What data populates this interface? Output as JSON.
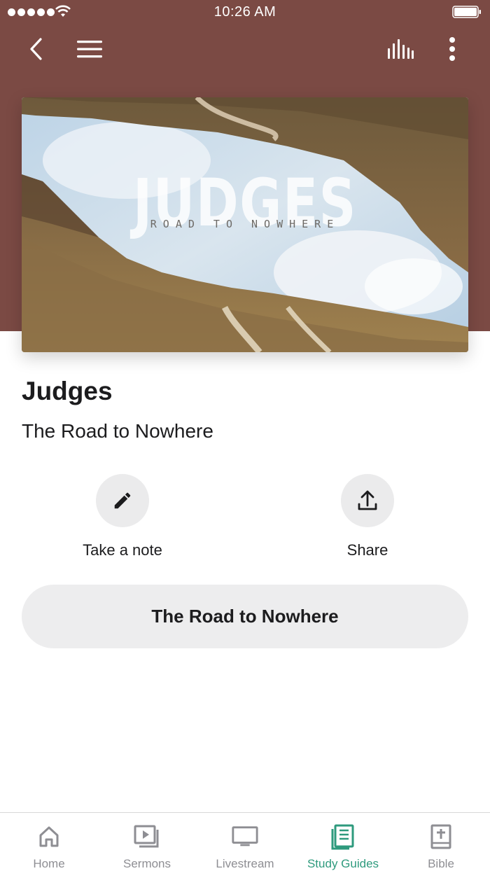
{
  "status_bar": {
    "time": "10:26 AM"
  },
  "nav": {
    "back_icon": "chevron-left-icon",
    "menu_icon": "hamburger-menu-icon",
    "audio_icon": "audio-levels-icon",
    "more_icon": "more-vertical-icon"
  },
  "hero": {
    "title": "JUDGES",
    "subtitle": "ROAD TO NOWHERE"
  },
  "page": {
    "title": "Judges",
    "subtitle": "The Road to Nowhere"
  },
  "actions": [
    {
      "label": "Take a note",
      "icon": "pencil-icon"
    },
    {
      "label": "Share",
      "icon": "share-upload-icon"
    }
  ],
  "primary_button": {
    "label": "The Road to Nowhere"
  },
  "tab_bar": {
    "active": "Study Guides",
    "tabs": [
      {
        "label": "Home",
        "icon": "home-icon"
      },
      {
        "label": "Sermons",
        "icon": "play-video-icon"
      },
      {
        "label": "Livestream",
        "icon": "monitor-icon"
      },
      {
        "label": "Study Guides",
        "icon": "guide-book-icon"
      },
      {
        "label": "Bible",
        "icon": "bible-icon"
      }
    ]
  },
  "colors": {
    "header": "#7b4a44",
    "accent": "#2e9a7d",
    "tab_inactive": "#8e8e93",
    "button_bg": "#ededee"
  }
}
